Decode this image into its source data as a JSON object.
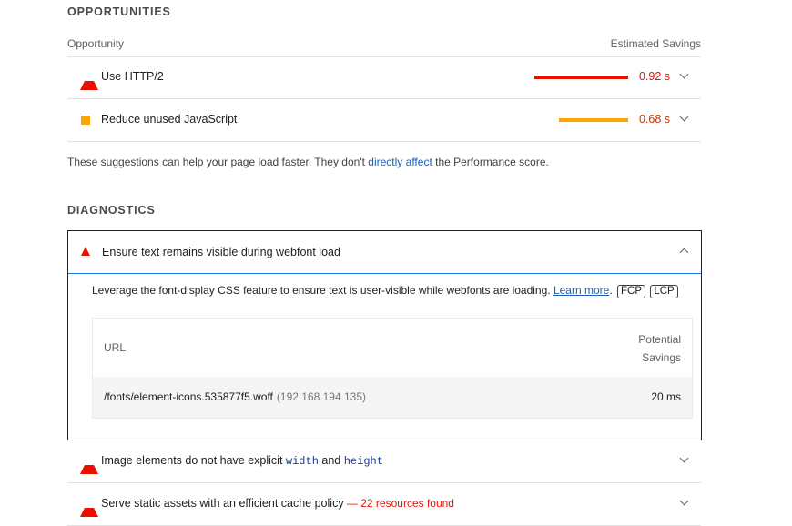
{
  "opportunities": {
    "section_title": "OPPORTUNITIES",
    "col_opportunity": "Opportunity",
    "col_savings": "Estimated Savings",
    "items": [
      {
        "icon": "fail-triangle-icon",
        "title": "Use HTTP/2",
        "savings": "0.92 s",
        "bar_fraction": 1.0,
        "color": "#eb0f00"
      },
      {
        "icon": "average-square-icon",
        "title": "Reduce unused JavaScript",
        "savings": "0.68 s",
        "bar_fraction": 0.74,
        "color": "#ffa400"
      }
    ],
    "note_before": "These suggestions can help your page load faster. They don't ",
    "note_link": "directly affect",
    "note_after": " the Performance score."
  },
  "diagnostics": {
    "section_title": "DIAGNOSTICS",
    "expanded": {
      "title": "Ensure text remains visible during webfont load",
      "description": "Leverage the font-display CSS feature to ensure text is user-visible while webfonts are loading.",
      "learn_more": "Learn more",
      "tags": [
        "FCP",
        "LCP"
      ],
      "table": {
        "col_url": "URL",
        "col_savings_line1": "Potential",
        "col_savings_line2": "Savings",
        "rows": [
          {
            "url": "/fonts/element-icons.535877f5.woff",
            "host": "(192.168.194.135)",
            "savings": "20 ms"
          }
        ]
      }
    },
    "items": [
      {
        "title_a": "Image elements do not have explicit ",
        "code1": "width",
        "title_b": " and ",
        "code2": "height"
      },
      {
        "title": "Serve static assets with an efficient cache policy",
        "sep": " — ",
        "detail": "22 resources found"
      }
    ]
  },
  "colors": {
    "fail": "#eb0f00",
    "average": "#ffa400",
    "link": "#1a5fb4",
    "focus": "#1a73e8"
  }
}
